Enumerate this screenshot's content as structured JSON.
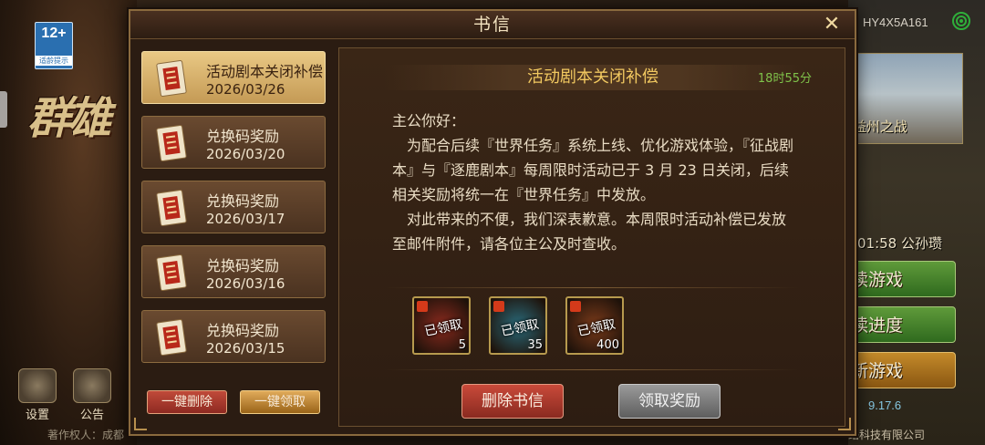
{
  "background": {
    "age_rating": {
      "number": "12+",
      "sub": "适龄提示"
    },
    "logo_text": "群雄",
    "account_id": "HY4X5A161",
    "scene_label": "·益州之战",
    "server_row": "01:58 公孙瓒",
    "right_buttons": [
      "续游戏",
      "读进度",
      "新游戏"
    ],
    "version": "9.17.6",
    "bottom_buttons": [
      "设置",
      "公告"
    ],
    "copyright_left": "著作权人：成都",
    "copyright_right": "络科技有限公司"
  },
  "dialog": {
    "title": "书信",
    "close": "✕",
    "mails": [
      {
        "title": "活动剧本关闭补偿",
        "date": "2026/03/26",
        "selected": true
      },
      {
        "title": "兑换码奖励",
        "date": "2026/03/20",
        "selected": false
      },
      {
        "title": "兑换码奖励",
        "date": "2026/03/17",
        "selected": false
      },
      {
        "title": "兑换码奖励",
        "date": "2026/03/16",
        "selected": false
      },
      {
        "title": "兑换码奖励",
        "date": "2026/03/15",
        "selected": false
      }
    ],
    "delete_all": "一键删除",
    "claim_all": "一键领取",
    "content": {
      "subject": "活动剧本关闭补偿",
      "timer": "18时55分",
      "greeting": "主公你好：",
      "paragraph1": "　为配合后续『世界任务』系统上线、优化游戏体验，『征战剧本』与『逐鹿剧本』每周限时活动已于 3 月 23 日关闭，后续相关奖励将统一在『世界任务』中发放。",
      "paragraph2": "　对此带来的不便，我们深表歉意。本周限时活动补偿已发放至邮件附件，请各位主公及时查收。",
      "rewards": [
        {
          "stamp": "已领取",
          "count": "5",
          "color": "#8a2a1e"
        },
        {
          "stamp": "已领取",
          "count": "35",
          "color": "#2a6a7a"
        },
        {
          "stamp": "已领取",
          "count": "400",
          "color": "#7a3a1a"
        }
      ],
      "delete_button": "删除书信",
      "claim_button": "领取奖励"
    }
  }
}
